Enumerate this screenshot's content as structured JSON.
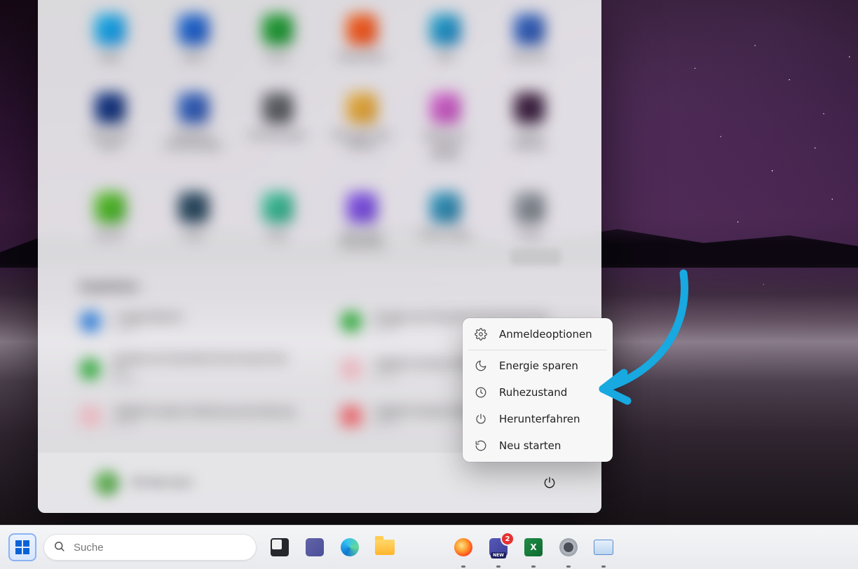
{
  "start_menu": {
    "apps": [
      {
        "label": "Edge"
      },
      {
        "label": "Word"
      },
      {
        "label": "Excel"
      },
      {
        "label": "PowerPoint"
      },
      {
        "label": "Mail"
      },
      {
        "label": "Kalender"
      },
      {
        "label": "Microsoft Store"
      },
      {
        "label": "Windows-Einstellungen"
      },
      {
        "label": "Einstellungen"
      },
      {
        "label": "Microsoft 365 (Office)"
      },
      {
        "label": "Solitaire & Casual Games"
      },
      {
        "label": "Adobe Express"
      },
      {
        "label": "Spotify"
      },
      {
        "label": "Xbox"
      },
      {
        "label": "Xbox"
      },
      {
        "label": "Microsoft Clipchamp"
      },
      {
        "label": "Prime Video"
      },
      {
        "label": "TikTok"
      }
    ],
    "recommended_title": "Empfohlen",
    "more_label": "Mehr",
    "recommended": [
      {
        "line1": "1 Approbation",
        "line2": "Jul 30"
      },
      {
        "line1": "Google als Standard-Suchmaschine",
        "line2": "Jul 30"
      },
      {
        "line1": "Google als Standard-Suchmaschine im",
        "line2": "Jul 30"
      },
      {
        "line1": "180620 Artikel GSH2",
        "line2": "Jul 30"
      },
      {
        "line1": "180920 zweite Stellenausschreibung",
        "line2": "Jul 30"
      },
      {
        "line1": "180620 Artikel GSH2",
        "line2": "Jul 30"
      }
    ],
    "user_name": "DE Benutzer"
  },
  "power_menu": {
    "signin_options": "Anmeldeoptionen",
    "energy_save": "Energie sparen",
    "hibernate": "Ruhezustand",
    "shutdown": "Herunterfahren",
    "restart": "Neu starten"
  },
  "taskbar": {
    "search_placeholder": "Suche",
    "teams_badge": "2"
  }
}
